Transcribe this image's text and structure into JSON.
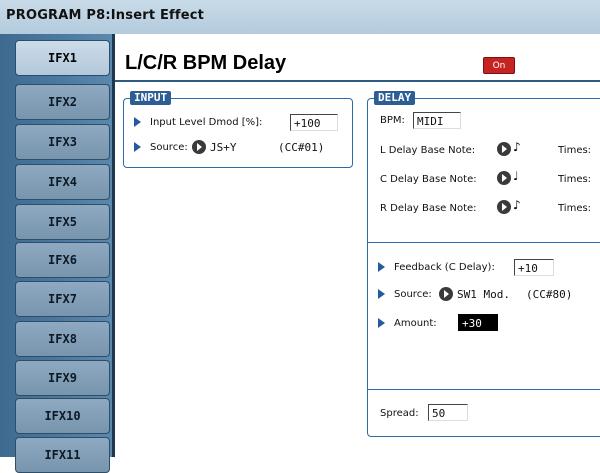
{
  "header": {
    "title": "PROGRAM P8:Insert Effect"
  },
  "tabs": [
    "IFX1",
    "IFX2",
    "IFX3",
    "IFX4",
    "IFX5",
    "IFX6",
    "IFX7",
    "IFX8",
    "IFX9",
    "IFX10",
    "IFX11"
  ],
  "effect": {
    "name": "L/C/R BPM Delay",
    "on_label": "On"
  },
  "input": {
    "label": "INPUT",
    "level_dmod_label": "Input Level Dmod [%]:",
    "level_dmod_value": "+100",
    "source_label": "Source:",
    "source_value": "JS+Y",
    "source_cc": "(CC#01)"
  },
  "delay": {
    "label": "DELAY",
    "bpm_label": "BPM:",
    "bpm_value": "MIDI",
    "l_label": "L Delay Base Note:",
    "c_label": "C Delay Base Note:",
    "r_label": "R Delay Base Note:",
    "l_note": "♪",
    "c_note": "♩",
    "r_note": "♪",
    "times_label": "Times:",
    "feedback_label": "Feedback (C Delay):",
    "feedback_value": "+10",
    "fb_source_label": "Source:",
    "fb_source_value": "SW1 Mod.",
    "fb_source_cc": "(CC#80)",
    "amount_label": "Amount:",
    "amount_value": "+30",
    "spread_label": "Spread:",
    "spread_value": "50"
  },
  "colors": {
    "accent": "#2c5e93",
    "on": "#c62323",
    "sidebar": "#4b7aa1"
  }
}
